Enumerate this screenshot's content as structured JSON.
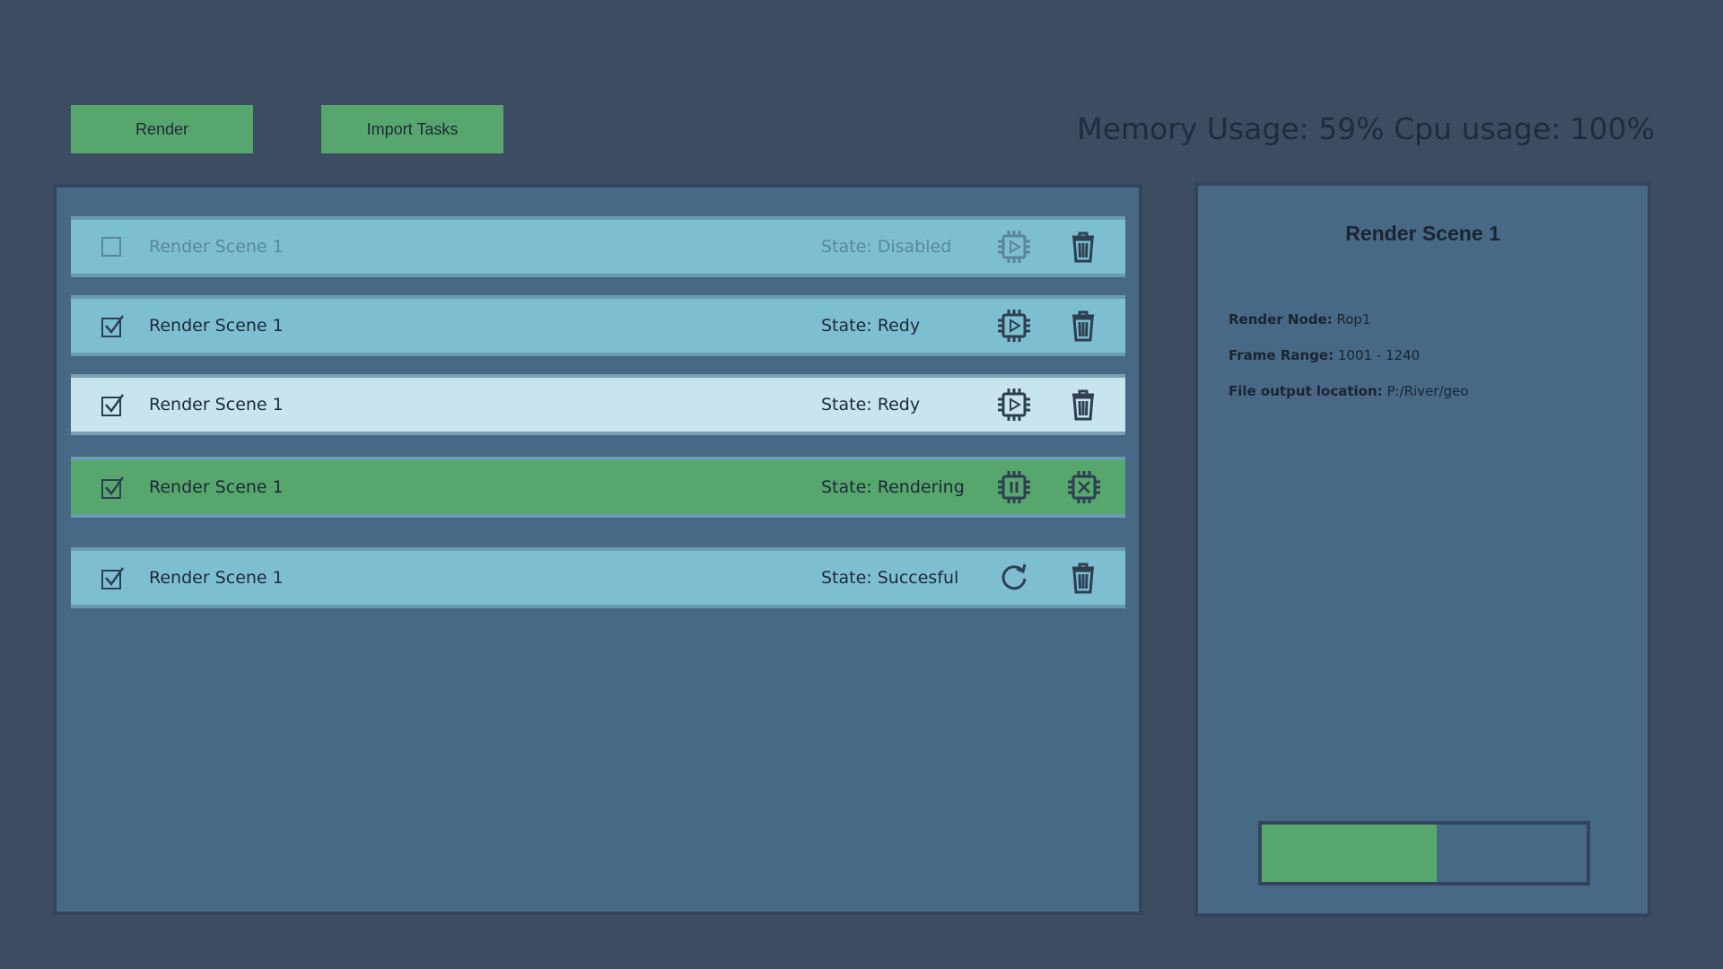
{
  "toolbar": {
    "render_label": "Render",
    "import_label": "Import Tasks"
  },
  "stats": {
    "text": "Memory Usage: 59% Cpu usage: 100%",
    "memory_percent": 59,
    "cpu_percent": 100
  },
  "tasks": [
    {
      "name": "Render Scene 1",
      "state": "State: Disabled",
      "checked": false,
      "variant": "disabled",
      "action_icon": "chip-play-icon",
      "secondary_icon": "trash-icon"
    },
    {
      "name": "Render Scene 1",
      "state": "State: Redy",
      "checked": true,
      "variant": "blue",
      "action_icon": "chip-play-icon",
      "secondary_icon": "trash-icon"
    },
    {
      "name": "Render Scene 1",
      "state": "State: Redy",
      "checked": true,
      "variant": "selected",
      "action_icon": "chip-play-icon",
      "secondary_icon": "trash-icon"
    },
    {
      "name": "Render Scene 1",
      "state": "State: Rendering",
      "checked": true,
      "variant": "green",
      "action_icon": "chip-pause-icon",
      "secondary_icon": "chip-cancel-icon"
    },
    {
      "name": "Render Scene 1",
      "state": "State: Succesful",
      "checked": true,
      "variant": "blue",
      "action_icon": "refresh-icon",
      "secondary_icon": "trash-icon"
    }
  ],
  "detail": {
    "title": "Render Scene 1",
    "render_node_label": "Render Node:",
    "render_node_value": "Rop1",
    "frame_range_label": "Frame Range:",
    "frame_range_value": "1001 - 1240",
    "output_label": "File output location:",
    "output_value": "P:/River/geo",
    "progress_fraction": 0.54
  },
  "colors": {
    "background": "#3c4c63",
    "panel": "#476985",
    "accent_green": "#57a66d",
    "row_blue": "#7ebed1",
    "row_selected": "#c8e4ec"
  }
}
